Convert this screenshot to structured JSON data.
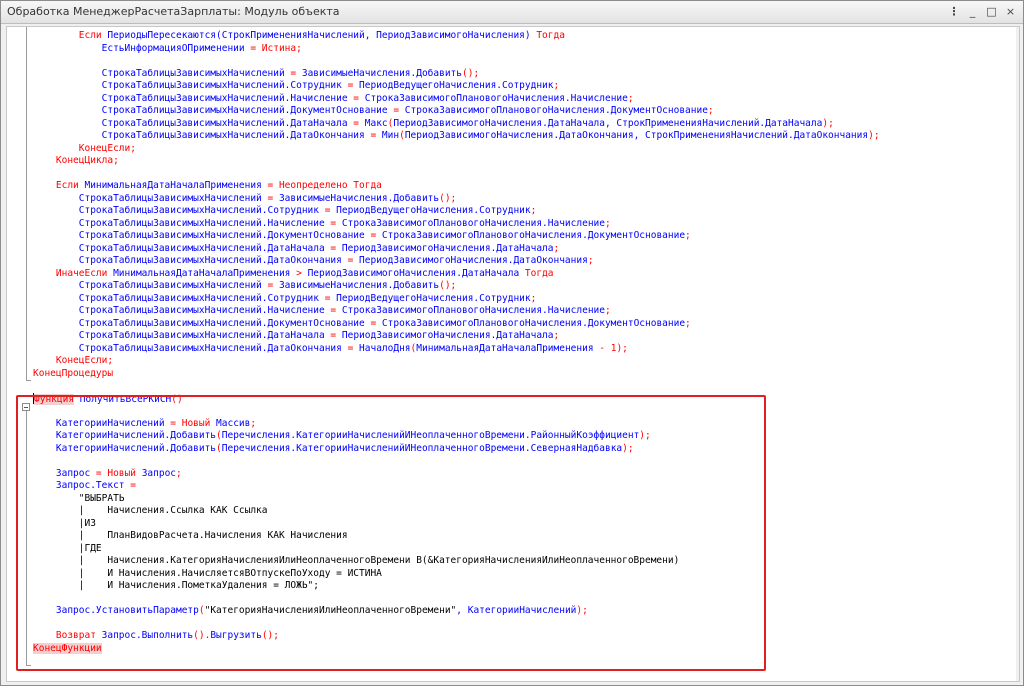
{
  "window": {
    "title": "Обработка МенеджерРасчетаЗарплаты: Модуль объекта",
    "menu_icon": "ellipsis-icon",
    "minimize_icon": "minimize-icon",
    "maximize_icon": "maximize-icon",
    "close_icon": "close-icon",
    "minimize_label": "_",
    "maximize_label": "□",
    "close_label": "×"
  },
  "colors": {
    "keyword": "#ff0000",
    "identifier": "#0000ff",
    "highlight_border": "#e02020"
  },
  "code_lines": [
    [
      [
        "kw",
        "        Если "
      ],
      [
        "id",
        "ПериодыПересекаются(СтрокПримененияНачислений, ПериодЗависимогоНачисления) "
      ],
      [
        "kw",
        "Тогда"
      ]
    ],
    [
      [
        "id",
        "            ЕстьИнформацияОПрименении "
      ],
      [
        "kw",
        "= Истина;"
      ]
    ],
    [
      [
        "plain",
        ""
      ]
    ],
    [
      [
        "id",
        "            СтрокаТаблицыЗависимыхНачислений "
      ],
      [
        "kw",
        "= "
      ],
      [
        "id",
        "ЗависимыеНачисления.Добавить"
      ],
      [
        "kw",
        "();"
      ]
    ],
    [
      [
        "id",
        "            СтрокаТаблицыЗависимыхНачислений.Сотрудник "
      ],
      [
        "kw",
        "= "
      ],
      [
        "id",
        "ПериодВедущегоНачисления.Сотрудник"
      ],
      [
        "kw",
        ";"
      ]
    ],
    [
      [
        "id",
        "            СтрокаТаблицыЗависимыхНачислений.Начисление "
      ],
      [
        "kw",
        "= "
      ],
      [
        "id",
        "СтрокаЗависимогоПлановогоНачисления.Начисление"
      ],
      [
        "kw",
        ";"
      ]
    ],
    [
      [
        "id",
        "            СтрокаТаблицыЗависимыхНачислений.ДокументОснование "
      ],
      [
        "kw",
        "= "
      ],
      [
        "id",
        "СтрокаЗависимогоПлановогоНачисления.ДокументОснование"
      ],
      [
        "kw",
        ";"
      ]
    ],
    [
      [
        "id",
        "            СтрокаТаблицыЗависимыхНачислений.ДатаНачала "
      ],
      [
        "kw",
        "= "
      ],
      [
        "id",
        "Макс"
      ],
      [
        "kw",
        "("
      ],
      [
        "id",
        "ПериодЗависимогоНачисления.ДатаНачала, СтрокПримененияНачислений.ДатаНачала"
      ],
      [
        "kw",
        ");"
      ]
    ],
    [
      [
        "id",
        "            СтрокаТаблицыЗависимыхНачислений.ДатаОкончания "
      ],
      [
        "kw",
        "= "
      ],
      [
        "id",
        "Мин"
      ],
      [
        "kw",
        "("
      ],
      [
        "id",
        "ПериодЗависимогоНачисления.ДатаОкончания, СтрокПримененияНачислений.ДатаОкончания"
      ],
      [
        "kw",
        ");"
      ]
    ],
    [
      [
        "kw",
        "        КонецЕсли;"
      ]
    ],
    [
      [
        "kw",
        "    КонецЦикла;"
      ]
    ],
    [
      [
        "plain",
        ""
      ]
    ],
    [
      [
        "kw",
        "    Если "
      ],
      [
        "id",
        "МинимальнаяДатаНачалаПрименения "
      ],
      [
        "kw",
        "= Неопределено Тогда"
      ]
    ],
    [
      [
        "id",
        "        СтрокаТаблицыЗависимыхНачислений "
      ],
      [
        "kw",
        "= "
      ],
      [
        "id",
        "ЗависимыеНачисления.Добавить"
      ],
      [
        "kw",
        "();"
      ]
    ],
    [
      [
        "id",
        "        СтрокаТаблицыЗависимыхНачислений.Сотрудник "
      ],
      [
        "kw",
        "= "
      ],
      [
        "id",
        "ПериодВедущегоНачисления.Сотрудник"
      ],
      [
        "kw",
        ";"
      ]
    ],
    [
      [
        "id",
        "        СтрокаТаблицыЗависимыхНачислений.Начисление "
      ],
      [
        "kw",
        "= "
      ],
      [
        "id",
        "СтрокаЗависимогоПлановогоНачисления.Начисление"
      ],
      [
        "kw",
        ";"
      ]
    ],
    [
      [
        "id",
        "        СтрокаТаблицыЗависимыхНачислений.ДокументОснование "
      ],
      [
        "kw",
        "= "
      ],
      [
        "id",
        "СтрокаЗависимогоПлановогоНачисления.ДокументОснование"
      ],
      [
        "kw",
        ";"
      ]
    ],
    [
      [
        "id",
        "        СтрокаТаблицыЗависимыхНачислений.ДатаНачала "
      ],
      [
        "kw",
        "= "
      ],
      [
        "id",
        "ПериодЗависимогоНачисления.ДатаНачала"
      ],
      [
        "kw",
        ";"
      ]
    ],
    [
      [
        "id",
        "        СтрокаТаблицыЗависимыхНачислений.ДатаОкончания "
      ],
      [
        "kw",
        "= "
      ],
      [
        "id",
        "ПериодЗависимогоНачисления.ДатаОкончания"
      ],
      [
        "kw",
        ";"
      ]
    ],
    [
      [
        "kw",
        "    ИначеЕсли "
      ],
      [
        "id",
        "МинимальнаяДатаНачалаПрименения "
      ],
      [
        "kw",
        "> "
      ],
      [
        "id",
        "ПериодЗависимогоНачисления.ДатаНачала "
      ],
      [
        "kw",
        "Тогда"
      ]
    ],
    [
      [
        "id",
        "        СтрокаТаблицыЗависимыхНачислений "
      ],
      [
        "kw",
        "= "
      ],
      [
        "id",
        "ЗависимыеНачисления.Добавить"
      ],
      [
        "kw",
        "();"
      ]
    ],
    [
      [
        "id",
        "        СтрокаТаблицыЗависимыхНачислений.Сотрудник "
      ],
      [
        "kw",
        "= "
      ],
      [
        "id",
        "ПериодВедущегоНачисления.Сотрудник"
      ],
      [
        "kw",
        ";"
      ]
    ],
    [
      [
        "id",
        "        СтрокаТаблицыЗависимыхНачислений.Начисление "
      ],
      [
        "kw",
        "= "
      ],
      [
        "id",
        "СтрокаЗависимогоПлановогоНачисления.Начисление"
      ],
      [
        "kw",
        ";"
      ]
    ],
    [
      [
        "id",
        "        СтрокаТаблицыЗависимыхНачислений.ДокументОснование "
      ],
      [
        "kw",
        "= "
      ],
      [
        "id",
        "СтрокаЗависимогоПлановогоНачисления.ДокументОснование"
      ],
      [
        "kw",
        ";"
      ]
    ],
    [
      [
        "id",
        "        СтрокаТаблицыЗависимыхНачислений.ДатаНачала "
      ],
      [
        "kw",
        "= "
      ],
      [
        "id",
        "ПериодЗависимогоНачисления.ДатаНачала"
      ],
      [
        "kw",
        ";"
      ]
    ],
    [
      [
        "id",
        "        СтрокаТаблицыЗависимыхНачислений.ДатаОкончания "
      ],
      [
        "kw",
        "= "
      ],
      [
        "id",
        "НачалоДня"
      ],
      [
        "kw",
        "("
      ],
      [
        "id",
        "МинимальнаяДатаНачалаПрименения "
      ],
      [
        "kw",
        "- 1);"
      ]
    ],
    [
      [
        "kw",
        "    КонецЕсли;"
      ]
    ],
    [
      [
        "kw",
        "КонецПроцедуры"
      ]
    ],
    [
      [
        "plain",
        ""
      ]
    ],
    [
      [
        "fn",
        "Функция"
      ],
      [
        "id",
        " ПолучитьВсеРКиСН"
      ],
      [
        "kw",
        "()"
      ]
    ],
    [
      [
        "plain",
        ""
      ]
    ],
    [
      [
        "id",
        "    КатегорииНачислений "
      ],
      [
        "kw",
        "= Новый "
      ],
      [
        "id",
        "Массив"
      ],
      [
        "kw",
        ";"
      ]
    ],
    [
      [
        "id",
        "    КатегорииНачислений.Добавить"
      ],
      [
        "kw",
        "("
      ],
      [
        "id",
        "Перечисления.КатегорииНачисленийИНеоплаченногоВремени.РайонныйКоэффициент"
      ],
      [
        "kw",
        ");"
      ]
    ],
    [
      [
        "id",
        "    КатегорииНачислений.Добавить"
      ],
      [
        "kw",
        "("
      ],
      [
        "id",
        "Перечисления.КатегорииНачисленийИНеоплаченногоВремени.СевернаяНадбавка"
      ],
      [
        "kw",
        ");"
      ]
    ],
    [
      [
        "plain",
        ""
      ]
    ],
    [
      [
        "id",
        "    Запрос "
      ],
      [
        "kw",
        "= Новый "
      ],
      [
        "id",
        "Запрос"
      ],
      [
        "kw",
        ";"
      ]
    ],
    [
      [
        "id",
        "    Запрос.Текст "
      ],
      [
        "kw",
        "="
      ]
    ],
    [
      [
        "str",
        "        \"ВЫБРАТЬ"
      ]
    ],
    [
      [
        "str",
        "        |    Начисления.Ссылка КАК Ссылка"
      ]
    ],
    [
      [
        "str",
        "        |ИЗ"
      ]
    ],
    [
      [
        "str",
        "        |    ПланВидовРасчета.Начисления КАК Начисления"
      ]
    ],
    [
      [
        "str",
        "        |ГДЕ"
      ]
    ],
    [
      [
        "str",
        "        |    Начисления.КатегорияНачисленияИлиНеоплаченногоВремени В(&КатегорияНачисленияИлиНеоплаченногоВремени)"
      ]
    ],
    [
      [
        "str",
        "        |    И Начисления.НачисляетсяВОтпускеПоУходу = ИСТИНА"
      ]
    ],
    [
      [
        "str",
        "        |    И Начисления.ПометкаУдаления = ЛОЖЬ\";"
      ]
    ],
    [
      [
        "plain",
        ""
      ]
    ],
    [
      [
        "id",
        "    Запрос.УстановитьПараметр"
      ],
      [
        "kw",
        "("
      ],
      [
        "str",
        "\"КатегорияНачисленияИлиНеоплаченногоВремени\""
      ],
      [
        "id",
        ", КатегорииНачислений"
      ],
      [
        "kw",
        ");"
      ]
    ],
    [
      [
        "plain",
        ""
      ]
    ],
    [
      [
        "kw",
        "    Возврат "
      ],
      [
        "id",
        "Запрос.Выполнить"
      ],
      [
        "kw",
        "()."
      ],
      [
        "id",
        "Выгрузить"
      ],
      [
        "kw",
        "();"
      ]
    ],
    [
      [
        "fnend",
        "КонецФункции"
      ]
    ]
  ]
}
